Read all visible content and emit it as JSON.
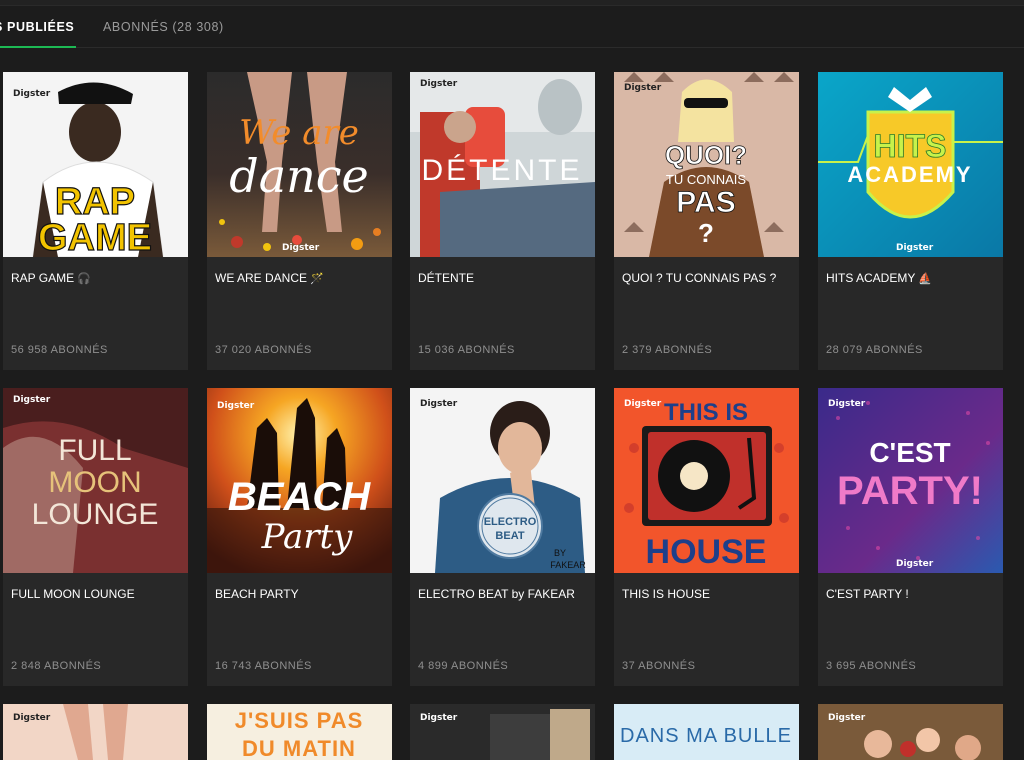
{
  "tabs": {
    "published": "S PUBLIÉES",
    "followers": "ABONNÉS (28 308)"
  },
  "brand": "Digster",
  "playlists": [
    {
      "title": "RAP GAME",
      "emoji": "🎧",
      "subscribers": "56 958 ABONNÉS",
      "cover_text": [
        "RAP",
        "GAME"
      ]
    },
    {
      "title": "WE ARE DANCE",
      "emoji": "🪄",
      "subscribers": "37 020 ABONNÉS",
      "cover_text": [
        "We are",
        "dance"
      ]
    },
    {
      "title": "DÉTENTE",
      "emoji": "",
      "subscribers": "15 036 ABONNÉS",
      "cover_text": [
        "DÉTENTE"
      ]
    },
    {
      "title": "QUOI ? TU CONNAIS PAS ?",
      "emoji": "",
      "subscribers": "2 379 ABONNÉS",
      "cover_text": [
        "QUOI?",
        "TU CONNAIS",
        "PAS",
        "?"
      ]
    },
    {
      "title": "HITS ACADEMY",
      "emoji": "⛵",
      "subscribers": "28 079 ABONNÉS",
      "cover_text": [
        "HITS",
        "ACADEMY"
      ]
    },
    {
      "title": "FULL MOON LOUNGE",
      "emoji": "",
      "subscribers": "2 848 ABONNÉS",
      "cover_text": [
        "FULL",
        "MOON",
        "LOUNGE"
      ]
    },
    {
      "title": "BEACH PARTY",
      "emoji": "",
      "subscribers": "16 743 ABONNÉS",
      "cover_text": [
        "BEACH",
        "Party"
      ]
    },
    {
      "title": "ELECTRO BEAT by FAKEAR",
      "emoji": "",
      "subscribers": "4 899 ABONNÉS",
      "cover_text": [
        "ELECTRO",
        "BEAT",
        "BY",
        "FAKEAR"
      ]
    },
    {
      "title": "THIS IS HOUSE",
      "emoji": "",
      "subscribers": "37 ABONNÉS",
      "cover_text": [
        "THIS IS",
        "HOUSE"
      ]
    },
    {
      "title": "C'EST PARTY !",
      "emoji": "",
      "subscribers": "3 695 ABONNÉS",
      "cover_text": [
        "C'EST",
        "PARTY!"
      ]
    }
  ],
  "partial_row": [
    {
      "cover_text": []
    },
    {
      "cover_text": [
        "J'SUIS PAS",
        "DU MATIN"
      ]
    },
    {
      "cover_text": []
    },
    {
      "cover_text": [
        "DANS MA BULLE"
      ]
    },
    {
      "cover_text": []
    }
  ]
}
